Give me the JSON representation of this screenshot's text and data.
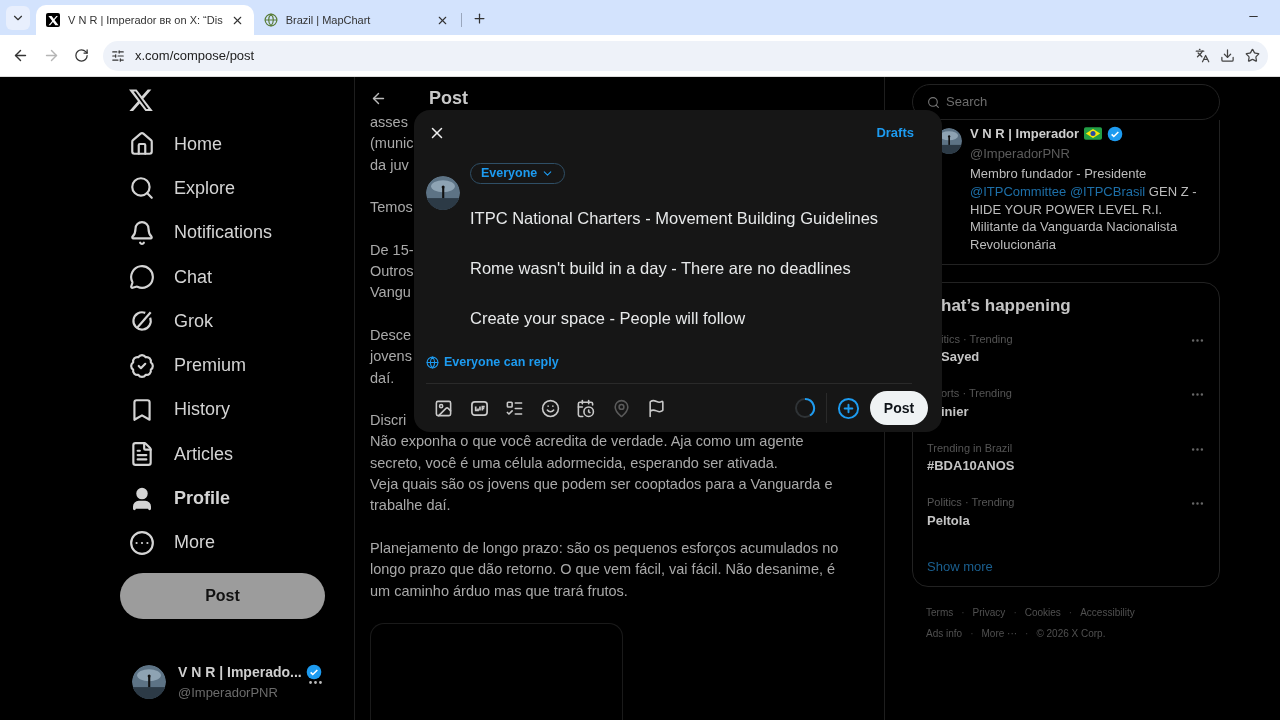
{
  "browser": {
    "tabs": [
      {
        "title": "V N R | Imperador ʙʀ on X: “Dis",
        "selected": true
      },
      {
        "title": "Brazil | MapChart",
        "selected": false
      }
    ],
    "url": "x.com/compose/post"
  },
  "nav": {
    "items": [
      {
        "label": "Home",
        "selected": false
      },
      {
        "label": "Explore",
        "selected": false
      },
      {
        "label": "Notifications",
        "selected": false
      },
      {
        "label": "Chat",
        "selected": false
      },
      {
        "label": "Grok",
        "selected": false
      },
      {
        "label": "Premium",
        "selected": false
      },
      {
        "label": "History",
        "selected": false
      },
      {
        "label": "Articles",
        "selected": false
      },
      {
        "label": "Profile",
        "selected": true
      },
      {
        "label": "More",
        "selected": false
      }
    ],
    "post_button": "Post",
    "account": {
      "name": "V N R | Imperado...",
      "handle": "@ImperadorPNR",
      "verified": true
    }
  },
  "post_column": {
    "title": "Post",
    "paragraphs": [
      {
        "lines": [
          "asses",
          "(munic",
          "da juv"
        ]
      },
      {
        "lines": [
          "Temos"
        ]
      },
      {
        "lines": [
          "De 15-",
          "Outros",
          "Vangu"
        ]
      },
      {
        "lines": [
          "Desce",
          "jovens",
          "daí."
        ]
      },
      {
        "heading": "Discri",
        "lines": [
          "Não exponha o que você acredita de verdade. Aja como um agente",
          "secreto, você é uma célula adormecida, esperando ser ativada.",
          "Veja quais são os jovens que podem ser cooptados para a Vanguarda e",
          "trabalhe daí."
        ]
      },
      {
        "lines": [
          "Planejamento de longo prazo: são os pequenos esforços acumulados no",
          "longo prazo que dão retorno. O que vem fácil, vai fácil. Não desanime, é",
          "um caminho árduo mas que trará frutos."
        ]
      }
    ]
  },
  "compose": {
    "drafts": "Drafts",
    "audience": "Everyone",
    "lines": [
      "ITPC National Charters - Movement Building Guidelines",
      "Rome wasn't build in a day - There are no deadlines",
      "Create your space - People will follow"
    ],
    "reply_setting": "Everyone can reply",
    "tools": [
      {
        "disabled": false
      },
      {
        "disabled": false
      },
      {
        "disabled": false
      },
      {
        "disabled": false
      },
      {
        "disabled": false
      },
      {
        "disabled": true
      },
      {
        "disabled": false
      }
    ],
    "post_button": "Post"
  },
  "right": {
    "search_placeholder": "Search",
    "profile": {
      "name": "V N R | Imperador",
      "handle": "@ImperadorPNR",
      "verified": true,
      "bio": [
        {
          "kind": "text",
          "text": "Membro fundador - Presidente"
        },
        {
          "kind": "mention",
          "text": "@ITPCommittee"
        },
        {
          "kind": "mention",
          "text": "@ITPCBrasil"
        },
        {
          "kind": "text",
          "text": "GEN Z - HIDE YOUR POWER LEVEL R.I. Militante da Vanguarda Nacionalista Revolucionária"
        }
      ]
    },
    "trending_title": "hat’s happening",
    "trends": [
      {
        "category": "itics · Trending",
        "title": "Sayed"
      },
      {
        "category": "orts · Trending",
        "title": "inier"
      },
      {
        "category": "Trending in Brazil",
        "title": "#BDA10ANOS"
      },
      {
        "category": "Politics · Trending",
        "title": "Peltola"
      }
    ],
    "show_more": "Show more",
    "footer_separator": "·",
    "footer": [
      [
        "Terms",
        "Privacy",
        "Cookies",
        "Accessibility"
      ],
      [
        "Ads info",
        "More ···",
        "© 2026 X Corp."
      ]
    ]
  }
}
